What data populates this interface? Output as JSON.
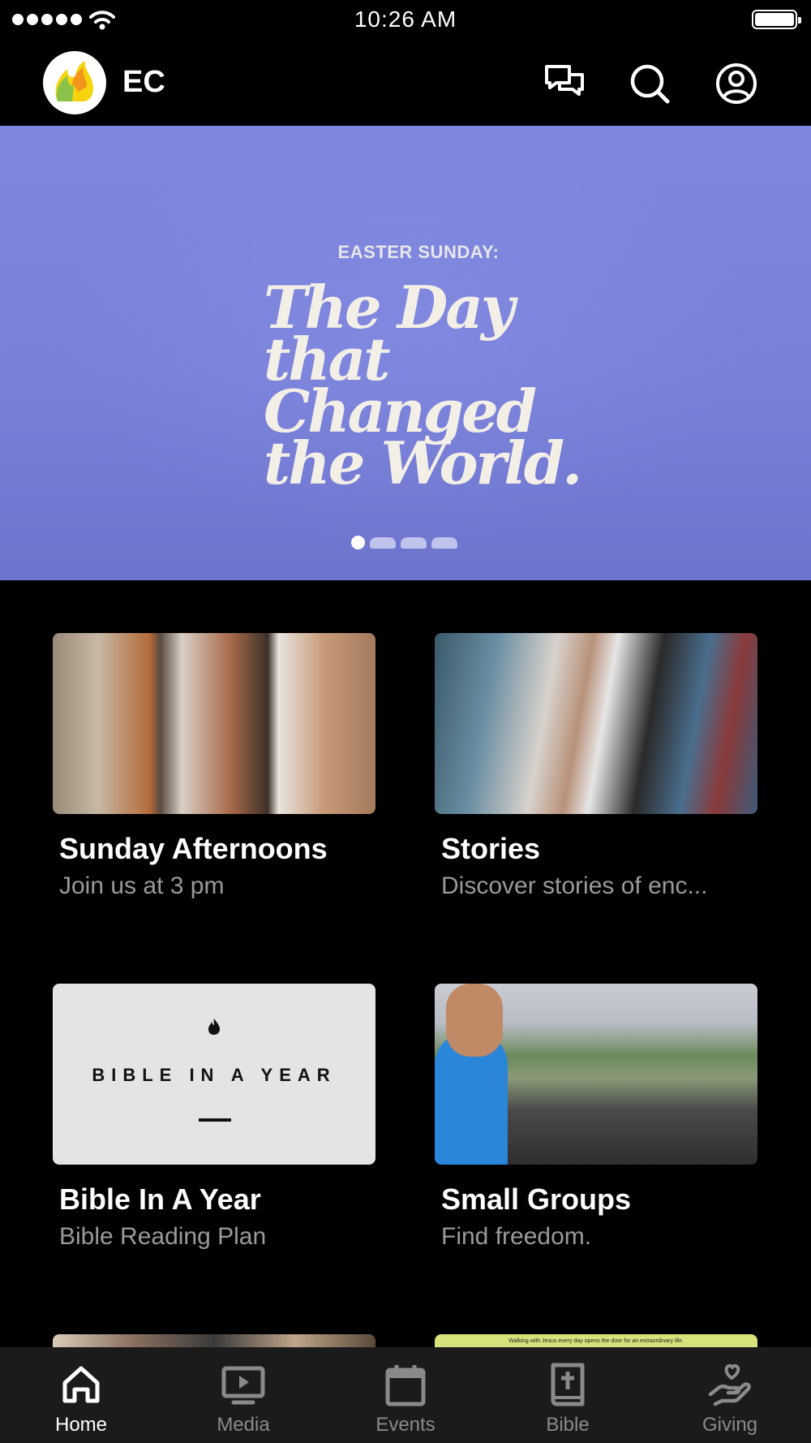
{
  "status_bar": {
    "time": "10:26 AM"
  },
  "header": {
    "org_name": "EC"
  },
  "hero": {
    "kicker": "EASTER SUNDAY:",
    "title": "The Day that Changed the World.",
    "slide_count": 4,
    "active_slide": 1
  },
  "cards": [
    {
      "title": "Sunday Afternoons",
      "subtitle": "Join us at 3 pm"
    },
    {
      "title": "Stories",
      "subtitle": "Discover stories of enc..."
    },
    {
      "title": "Bible In A Year",
      "subtitle": "Bible Reading Plan",
      "image_text": "BIBLE IN A YEAR"
    },
    {
      "title": "Small Groups",
      "subtitle": "Find freedom."
    }
  ],
  "peek_card_text": "Walking with Jesus every day opens the door for an extraordinary life.",
  "tabs": [
    {
      "label": "Home",
      "icon": "home-icon",
      "active": true
    },
    {
      "label": "Media",
      "icon": "media-icon",
      "active": false
    },
    {
      "label": "Events",
      "icon": "calendar-icon",
      "active": false
    },
    {
      "label": "Bible",
      "icon": "bible-icon",
      "active": false
    },
    {
      "label": "Giving",
      "icon": "giving-icon",
      "active": false
    }
  ],
  "colors": {
    "hero_bg": "#7e86de",
    "tab_bar_bg": "#1b1b1b",
    "inactive_tab": "#8a8a8a"
  }
}
